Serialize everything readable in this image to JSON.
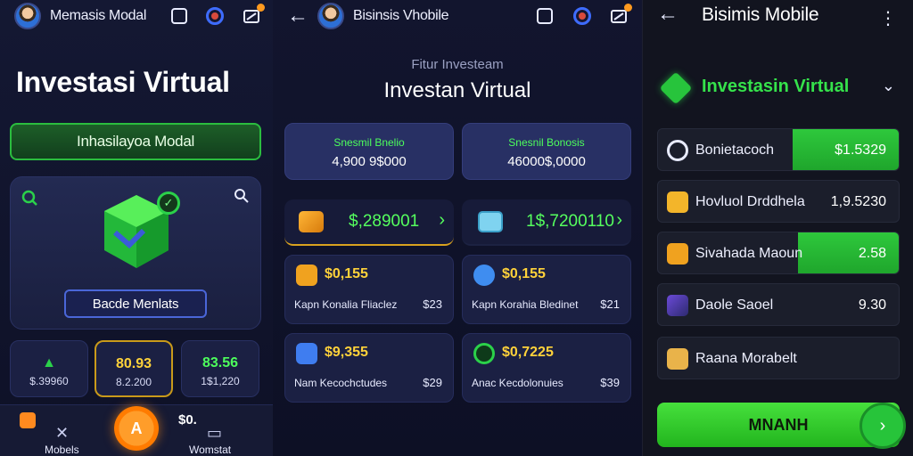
{
  "panel1": {
    "app_title": "Memasis Modal",
    "title": "Investasi Virtual",
    "banner": "Inhasilayoa Modal",
    "hero_button": "Bacde Menlats",
    "minis": [
      {
        "v1": "",
        "v2": "$.39960"
      },
      {
        "v1": "80.93",
        "v2": "8.2.200"
      },
      {
        "v1": "83.56",
        "v2": "1$1,220"
      }
    ],
    "partial_row": "$0.",
    "nav": {
      "left_label": "Mobels",
      "right_label": "Womstat",
      "fab_label": "A"
    }
  },
  "panel2": {
    "app_title": "Bisinsis Vhobile",
    "subtitle": "Fitur Investeam",
    "title": "Investan Virtual",
    "stats": [
      {
        "key": "Snesmil Bnelio",
        "value": "4,900 9$000"
      },
      {
        "key": "Snesnil Bonosis",
        "value": "46000$,0000"
      }
    ],
    "pills": [
      {
        "amount": "$,289001"
      },
      {
        "amount": "1$,7200110"
      }
    ],
    "cards": [
      {
        "amount": "$0,155",
        "label": "Kapn Konalia Fliaclez",
        "value": "$23"
      },
      {
        "amount": "$0,155",
        "label": "Kapn Korahia Bledinet",
        "value": "$21"
      },
      {
        "amount": "$9,355",
        "label": "Nam Kecochctudes",
        "value": "$29"
      },
      {
        "amount": "$0,7225",
        "label": "Anac Kecdolonuies",
        "value": "$39"
      }
    ]
  },
  "panel3": {
    "app_title": "Bisimis Mobile",
    "section_title": "Investasin Virtual",
    "rows": [
      {
        "name": "Bonietacoch",
        "value": "$1.5329",
        "fill_fraction": 0.44
      },
      {
        "name": "Hovluol Drddhela",
        "value": "1,9.5230",
        "fill_fraction": 0
      },
      {
        "name": "Sivahada Maoun",
        "value": "2.58",
        "fill_fraction": 0.42
      },
      {
        "name": "Daole Saoel",
        "value": "9.30",
        "fill_fraction": 0
      },
      {
        "name": "Raana Morabelt",
        "value": "",
        "fill_fraction": 0
      }
    ],
    "cta": "MNANH"
  },
  "colors": {
    "accent_green": "#2bd14a",
    "accent_orange": "#ff9a1f",
    "accent_blue": "#4a66d8"
  }
}
